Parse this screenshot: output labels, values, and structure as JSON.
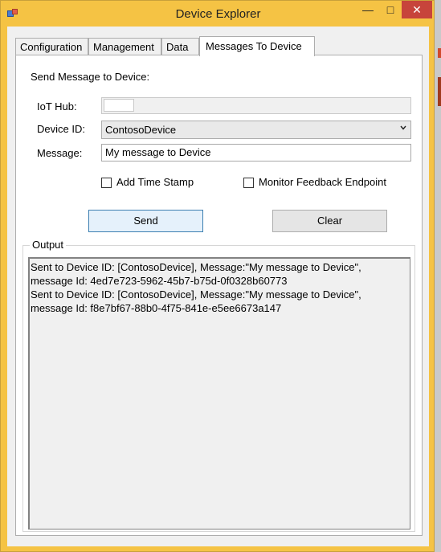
{
  "window": {
    "title": "Device Explorer",
    "controls": {
      "minimize": "—",
      "maximize": "□",
      "close": "✕"
    }
  },
  "tabs": [
    {
      "label": "Configuration"
    },
    {
      "label": "Management"
    },
    {
      "label": "Data"
    },
    {
      "label": "Messages To Device",
      "active": true
    }
  ],
  "form": {
    "heading": "Send Message to Device:",
    "iot_hub_label": "IoT Hub:",
    "iot_hub_value": "",
    "device_id_label": "Device ID:",
    "device_id_value": "ContosoDevice",
    "message_label": "Message:",
    "message_value": "My message to Device",
    "add_timestamp_label": "Add Time Stamp",
    "add_timestamp_checked": false,
    "monitor_feedback_label": "Monitor Feedback Endpoint",
    "monitor_feedback_checked": false
  },
  "buttons": {
    "send": "Send",
    "clear": "Clear"
  },
  "output": {
    "title": "Output",
    "lines": [
      "Sent to Device ID: [ContosoDevice], Message:\"My message to Device\",",
      "message Id: 4ed7e723-5962-45b7-b75d-0f0328b60773",
      "Sent to Device ID: [ContosoDevice], Message:\"My message to Device\",",
      "message Id: f8e7bf67-88b0-4f75-841e-e5ee6673a147"
    ]
  },
  "colors": {
    "title_bar": "#f5c344",
    "close_button": "#c7443b",
    "window_bg": "#f0f0f0"
  }
}
